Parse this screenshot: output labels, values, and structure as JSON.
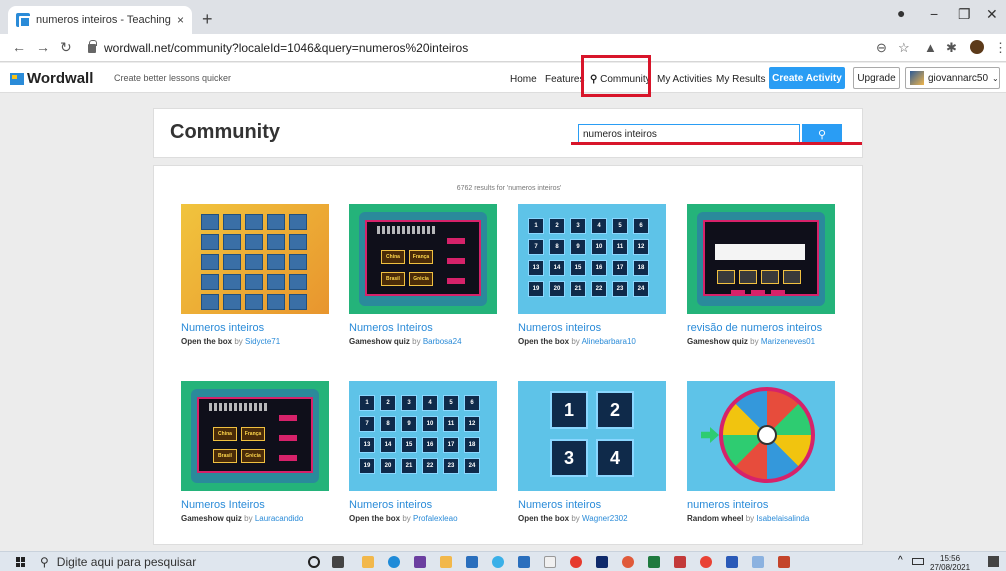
{
  "browser": {
    "tab_title": "numeros inteiros - Teaching reso",
    "tab_close": "×",
    "new_tab": "+",
    "url": "wordwall.net/community?localeId=1046&query=numeros%20inteiros",
    "win_min": "−",
    "win_max": "❐",
    "win_close": "✕"
  },
  "header": {
    "logo": "Wordwall",
    "tagline": "Create better lessons quicker",
    "nav": {
      "home": "Home",
      "features": "Features",
      "community": "Community",
      "my_activities": "My Activities",
      "my_results": "My Results"
    },
    "create_activity": "Create Activity",
    "upgrade": "Upgrade",
    "user": "giovannarc50"
  },
  "community": {
    "title": "Community",
    "search_value": "numeros inteiros"
  },
  "results": {
    "count_text": "6762 results for 'numeros inteiros'",
    "by": "by",
    "items": [
      {
        "title": "Numeros inteiros",
        "type": "Open the box",
        "author": "Sidycte71"
      },
      {
        "title": "Numeros Inteiros",
        "type": "Gameshow quiz",
        "author": "Barbosa24"
      },
      {
        "title": "Numeros inteiros",
        "type": "Open the box",
        "author": "Alinebarbara10"
      },
      {
        "title": "revisão de numeros inteiros",
        "type": "Gameshow quiz",
        "author": "Marizeneves01"
      },
      {
        "title": "Numeros Inteiros",
        "type": "Gameshow quiz",
        "author": "Lauracandido"
      },
      {
        "title": "Numeros inteiros",
        "type": "Open the box",
        "author": "Profalexleao"
      },
      {
        "title": "Numeros inteiros",
        "type": "Open the box",
        "author": "Wagner2302"
      },
      {
        "title": "numeros inteiros",
        "type": "Random wheel",
        "author": "Isabelaisalinda"
      }
    ],
    "quiz_words": [
      "China",
      "França",
      "Brasil",
      "Grécia"
    ],
    "grid_numbers": [
      "1",
      "2",
      "3",
      "4",
      "5",
      "6",
      "7",
      "8",
      "9",
      "10",
      "11",
      "12",
      "13",
      "14",
      "15",
      "16",
      "17",
      "18",
      "19",
      "20",
      "21",
      "22",
      "23",
      "24"
    ],
    "box4_numbers": [
      "1",
      "2",
      "3",
      "4"
    ]
  },
  "taskbar": {
    "search_placeholder": "Digite aqui para pesquisar",
    "time": "15:56",
    "date": "27/08/2021"
  }
}
